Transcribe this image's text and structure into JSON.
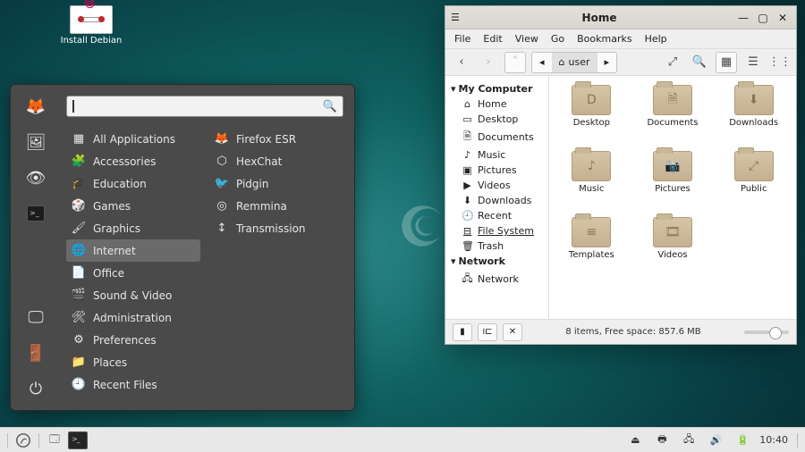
{
  "desktop": {
    "install_label": "Install Debian"
  },
  "appmenu": {
    "search_placeholder": "",
    "categories": [
      {
        "icon": "▦",
        "label": "All Applications"
      },
      {
        "icon": "🧩",
        "label": "Accessories"
      },
      {
        "icon": "🎓",
        "label": "Education"
      },
      {
        "icon": "🎲",
        "label": "Games"
      },
      {
        "icon": "🖌",
        "label": "Graphics"
      },
      {
        "icon": "🌐",
        "label": "Internet",
        "selected": true
      },
      {
        "icon": "📄",
        "label": "Office"
      },
      {
        "icon": "🎬",
        "label": "Sound & Video"
      },
      {
        "icon": "🛠",
        "label": "Administration"
      },
      {
        "icon": "⚙",
        "label": "Preferences"
      },
      {
        "icon": "📁",
        "label": "Places"
      },
      {
        "icon": "🕘",
        "label": "Recent Files"
      }
    ],
    "apps": [
      {
        "icon": "🦊",
        "label": "Firefox ESR"
      },
      {
        "icon": "⬡",
        "label": "HexChat"
      },
      {
        "icon": "🐦",
        "label": "Pidgin"
      },
      {
        "icon": "◎",
        "label": "Remmina"
      },
      {
        "icon": "↕",
        "label": "Transmission"
      }
    ]
  },
  "fm": {
    "title": "Home",
    "menus": [
      "File",
      "Edit",
      "View",
      "Go",
      "Bookmarks",
      "Help"
    ],
    "path_segment": "user",
    "sidebar": {
      "computer_header": "My Computer",
      "computer_items": [
        {
          "icon": "⌂",
          "label": "Home"
        },
        {
          "icon": "▭",
          "label": "Desktop"
        },
        {
          "icon": "🗎",
          "label": "Documents"
        },
        {
          "icon": "♪",
          "label": "Music"
        },
        {
          "icon": "▣",
          "label": "Pictures"
        },
        {
          "icon": "▶",
          "label": "Videos"
        },
        {
          "icon": "⬇",
          "label": "Downloads"
        },
        {
          "icon": "🕘",
          "label": "Recent"
        },
        {
          "icon": "⊟",
          "label": "File System",
          "selected": true
        },
        {
          "icon": "🗑",
          "label": "Trash"
        }
      ],
      "network_header": "Network",
      "network_items": [
        {
          "icon": "🖧",
          "label": "Network"
        }
      ]
    },
    "folders": [
      {
        "glyph": "D",
        "label": "Desktop"
      },
      {
        "glyph": "🗎",
        "label": "Documents"
      },
      {
        "glyph": "⬇",
        "label": "Downloads"
      },
      {
        "glyph": "♪",
        "label": "Music"
      },
      {
        "glyph": "📷",
        "label": "Pictures"
      },
      {
        "glyph": "⤢",
        "label": "Public"
      },
      {
        "glyph": "≡",
        "label": "Templates"
      },
      {
        "glyph": "🎞",
        "label": "Videos"
      }
    ],
    "status": "8 items, Free space: 857.6 MB"
  },
  "panel": {
    "clock": "10:40"
  }
}
